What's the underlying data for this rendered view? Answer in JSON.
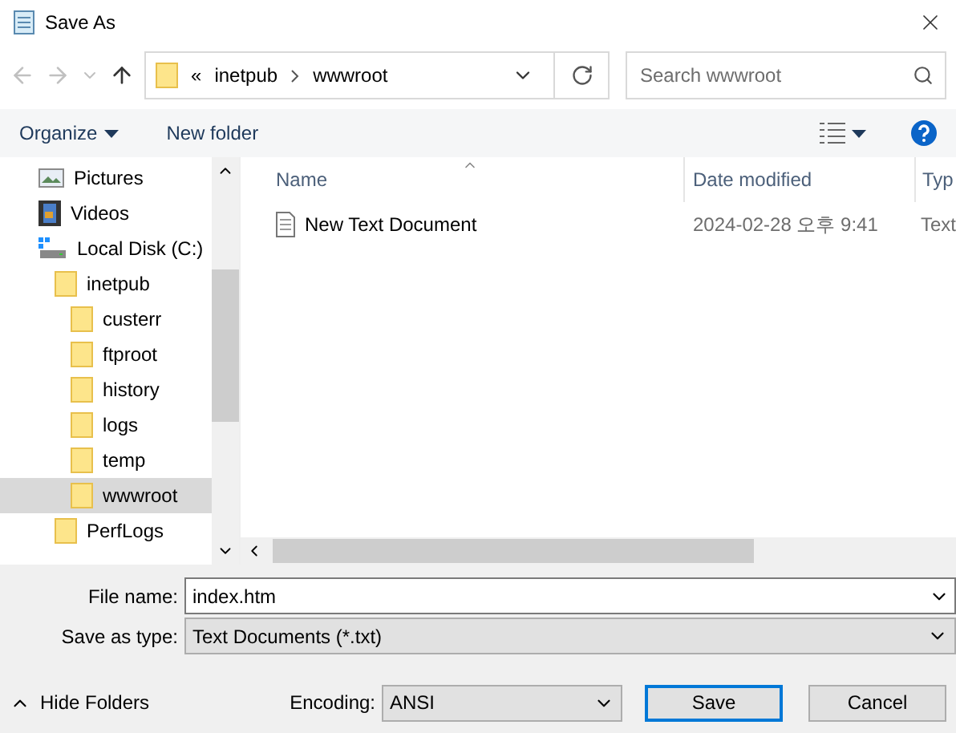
{
  "window": {
    "title": "Save As"
  },
  "address": {
    "overflow": "«",
    "crumbs": [
      "inetpub",
      "wwwroot"
    ]
  },
  "search": {
    "placeholder": "Search wwwroot"
  },
  "toolbar": {
    "organize": "Organize",
    "new_folder": "New folder"
  },
  "sidebar": {
    "items": [
      {
        "label": "Pictures",
        "kind": "pictures",
        "selected": false
      },
      {
        "label": "Videos",
        "kind": "videos",
        "selected": false
      },
      {
        "label": "Local Disk (C:)",
        "kind": "drive",
        "selected": false,
        "children": [
          {
            "label": "inetpub",
            "kind": "folder",
            "selected": false,
            "children": [
              {
                "label": "custerr",
                "kind": "folder",
                "selected": false
              },
              {
                "label": "ftproot",
                "kind": "folder",
                "selected": false
              },
              {
                "label": "history",
                "kind": "folder",
                "selected": false
              },
              {
                "label": "logs",
                "kind": "folder",
                "selected": false
              },
              {
                "label": "temp",
                "kind": "folder",
                "selected": false
              },
              {
                "label": "wwwroot",
                "kind": "folder",
                "selected": true
              }
            ]
          },
          {
            "label": "PerfLogs",
            "kind": "folder",
            "selected": false
          }
        ]
      }
    ]
  },
  "table": {
    "columns": [
      "Name",
      "Date modified",
      "Typ"
    ],
    "rows": [
      {
        "name": "New Text Document",
        "date": "2024-02-28 오후 9:41",
        "type": "Text"
      }
    ]
  },
  "file_name": {
    "label": "File name:",
    "value": "index.htm"
  },
  "save_type": {
    "label": "Save as type:",
    "value": "Text Documents (*.txt)"
  },
  "hide_folders": "Hide Folders",
  "encoding": {
    "label": "Encoding:",
    "value": "ANSI"
  },
  "buttons": [
    "Save",
    "Cancel"
  ]
}
